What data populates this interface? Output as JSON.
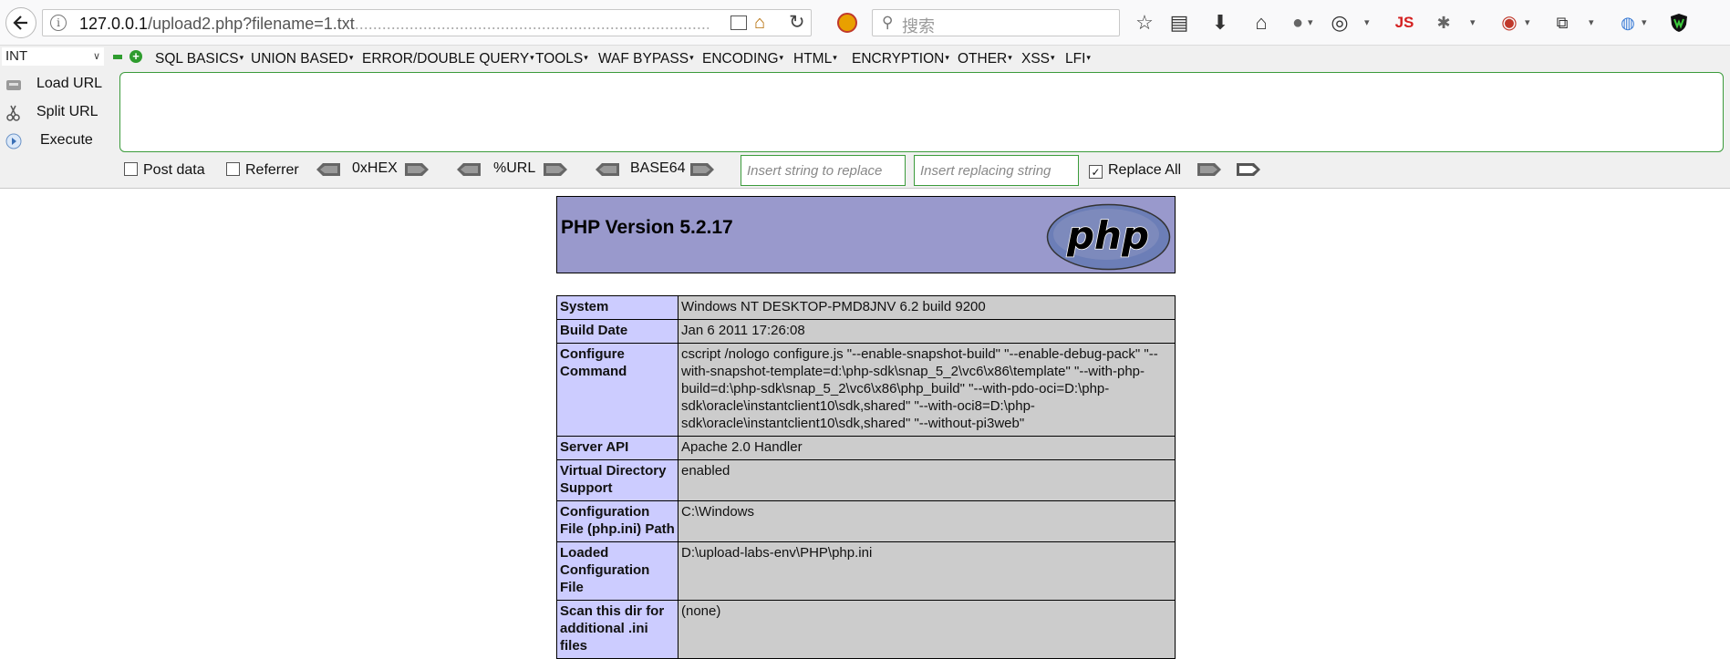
{
  "browser": {
    "url_host": "127.0.0.1",
    "url_rest": "/upload2.php?filename=1.txt",
    "search_placeholder": "搜索",
    "js_label": "JS"
  },
  "hackbar": {
    "select_value": "INT",
    "menus": [
      "SQL BASICS",
      "UNION BASED",
      "ERROR/DOUBLE QUERY",
      "TOOLS",
      "WAF BYPASS",
      "ENCODING",
      "HTML",
      "ENCRYPTION",
      "OTHER",
      "XSS",
      "LFI"
    ],
    "load_url": "Load URL",
    "split_url": "Split URL",
    "execute": "Execute",
    "post_data": "Post data",
    "referrer": "Referrer",
    "hex": "0xHEX",
    "url_enc": "%URL",
    "base64": "BASE64",
    "replace_placeholder": "Insert string to replace",
    "replacing_placeholder": "Insert replacing string",
    "replace_all": "Replace All"
  },
  "phpinfo": {
    "title": "PHP Version 5.2.17",
    "logo_text": "php",
    "rows": [
      {
        "key": "System",
        "value": "Windows NT DESKTOP-PMD8JNV 6.2 build 9200"
      },
      {
        "key": "Build Date",
        "value": "Jan 6 2011 17:26:08"
      },
      {
        "key": "Configure Command",
        "value": "cscript /nologo configure.js \"--enable-snapshot-build\" \"--enable-debug-pack\" \"--with-snapshot-template=d:\\php-sdk\\snap_5_2\\vc6\\x86\\template\" \"--with-php-build=d:\\php-sdk\\snap_5_2\\vc6\\x86\\php_build\" \"--with-pdo-oci=D:\\php-sdk\\oracle\\instantclient10\\sdk,shared\" \"--with-oci8=D:\\php-sdk\\oracle\\instantclient10\\sdk,shared\" \"--without-pi3web\""
      },
      {
        "key": "Server API",
        "value": "Apache 2.0 Handler"
      },
      {
        "key": "Virtual Directory Support",
        "value": "enabled"
      },
      {
        "key": "Configuration File (php.ini) Path",
        "value": "C:\\Windows"
      },
      {
        "key": "Loaded Configuration File",
        "value": "D:\\upload-labs-env\\PHP\\php.ini"
      },
      {
        "key": "Scan this dir for additional .ini files",
        "value": "(none)"
      }
    ]
  }
}
